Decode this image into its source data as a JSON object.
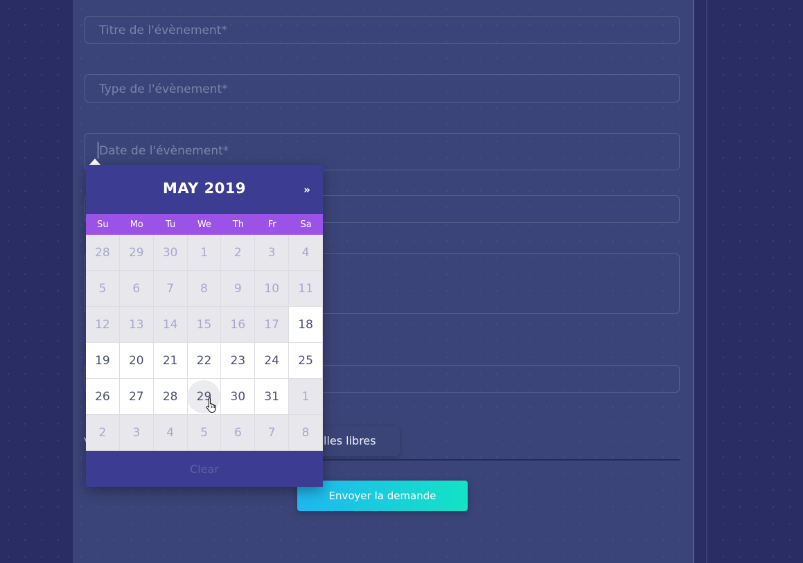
{
  "form": {
    "title_placeholder": "Titre de l'évènement*",
    "type_placeholder": "Type de l'évènement*",
    "date_placeholder": "Date de l'évènement*",
    "free_rooms_label": "lles libres",
    "left_tick": "V",
    "submit_label": "Envoyer la demande"
  },
  "datepicker": {
    "title": "MAY 2019",
    "next_label": "»",
    "clear_label": "Clear",
    "weekdays": [
      "Su",
      "Mo",
      "Tu",
      "We",
      "Th",
      "Fr",
      "Sa"
    ],
    "weeks": [
      [
        "28",
        "29",
        "30",
        "1",
        "2",
        "3",
        "4"
      ],
      [
        "5",
        "6",
        "7",
        "8",
        "9",
        "10",
        "11"
      ],
      [
        "12",
        "13",
        "14",
        "15",
        "16",
        "17",
        "18"
      ],
      [
        "19",
        "20",
        "21",
        "22",
        "23",
        "24",
        "25"
      ],
      [
        "26",
        "27",
        "28",
        "29",
        "30",
        "31",
        "1"
      ],
      [
        "2",
        "3",
        "4",
        "5",
        "6",
        "7",
        "8"
      ]
    ],
    "hovered_day": "29"
  },
  "colors": {
    "picker_header": "#3c3d92",
    "weekday_bar": "#9b52e6",
    "submit_gradient_start": "#1fb7f0",
    "submit_gradient_end": "#13e3c6"
  }
}
